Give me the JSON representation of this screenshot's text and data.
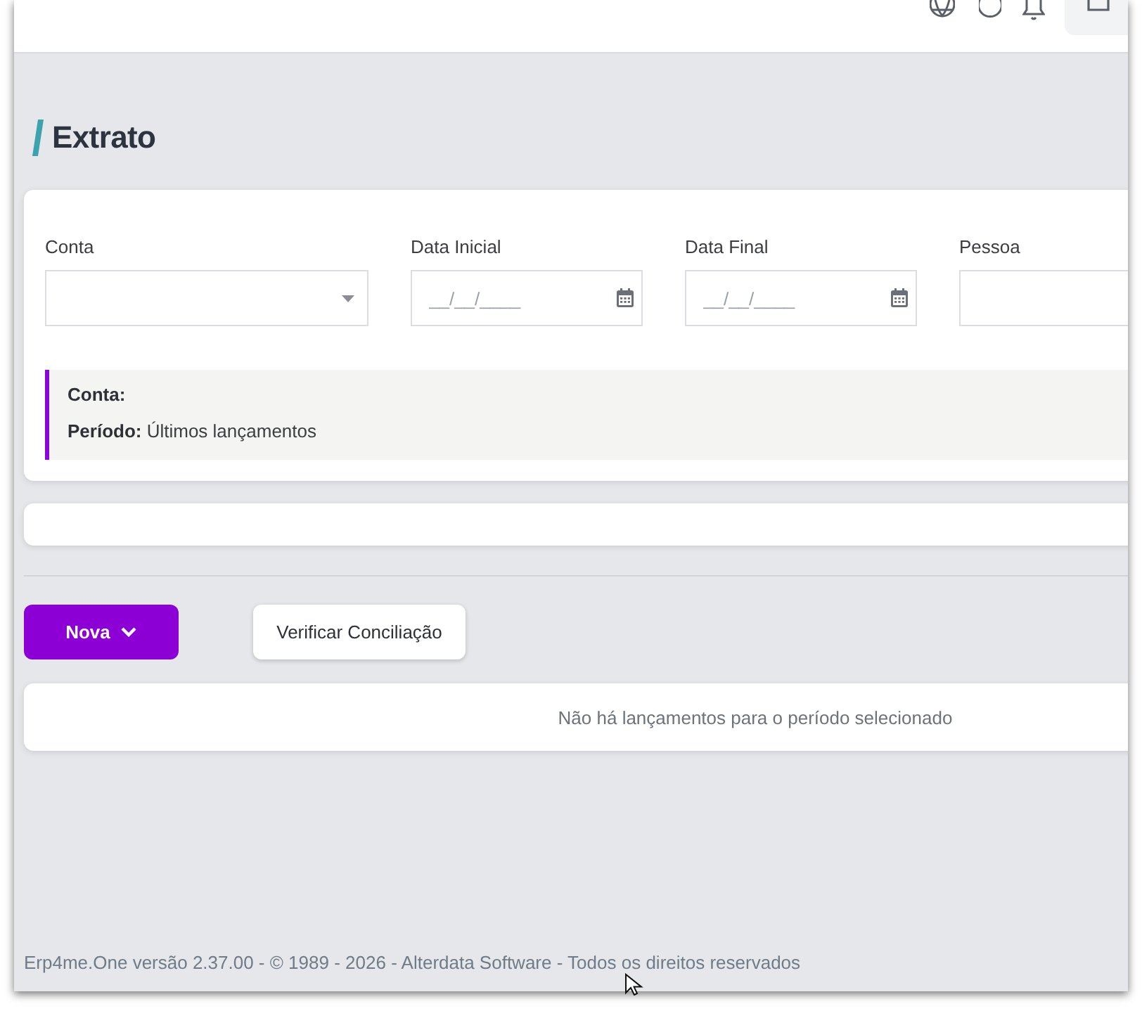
{
  "page_title": "Extrato",
  "filters": [
    {
      "label": "Conta",
      "kind": "select"
    },
    {
      "label": "Data Inicial",
      "kind": "date",
      "placeholder": "__/__/____"
    },
    {
      "label": "Data Final",
      "kind": "date",
      "placeholder": "__/__/____"
    },
    {
      "label": "Pessoa",
      "kind": "text"
    }
  ],
  "summary": [
    {
      "label": "Conta:"
    },
    {
      "label": "Período:",
      "value": "Últimos lançamentos"
    }
  ],
  "actions": [
    {
      "label": "Nova",
      "kind": "dropdown"
    },
    {
      "label": "Verificar Conciliação",
      "kind": "plain"
    }
  ],
  "empty_message": "Não há lançamentos para o período selecionado",
  "footer": "Erp4me.One versão 2.37.00 - © 1989 - 2026 - Alterdata Software - Todos os direitos reservados"
}
